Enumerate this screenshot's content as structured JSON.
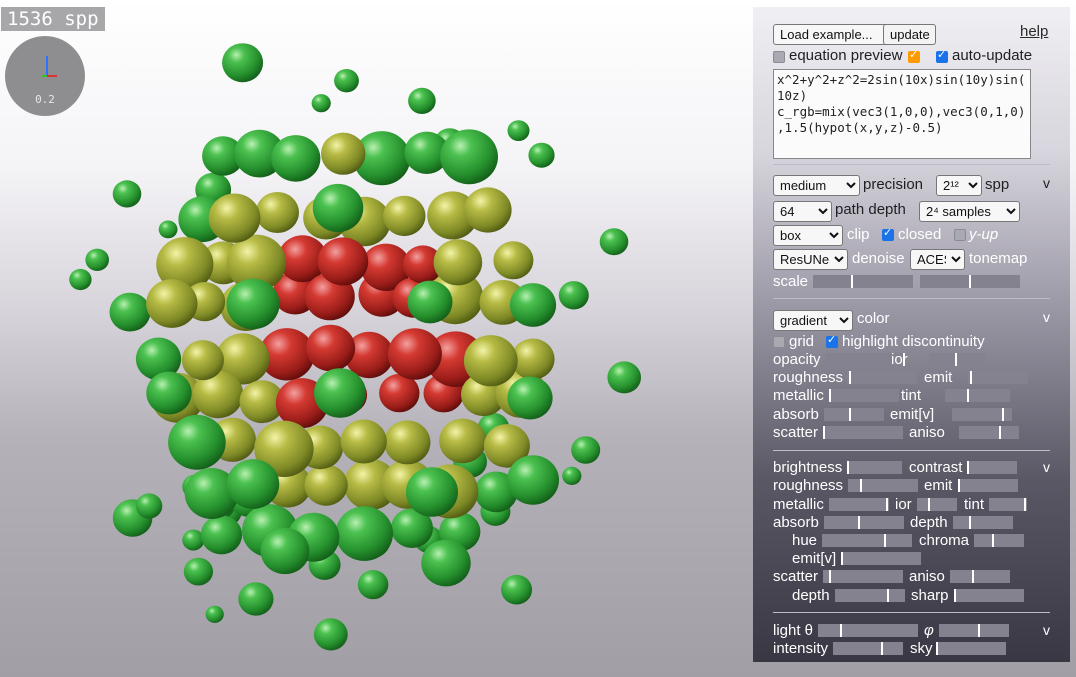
{
  "viewport": {
    "spp_label": "1536 spp",
    "axis_scale": "0.2"
  },
  "panel": {
    "example_select": "Load example...",
    "update_label": "update",
    "help_label": "help",
    "equation_preview": "equation preview",
    "auto_update": "auto-update",
    "equation": "x^2+y^2+z^2=2sin(10x)sin(10y)sin(10z)\nc_rgb=mix(vec3(1,0,0),vec3(0,1,0),1.5(hypot(x,y,z)-0.5)",
    "render": {
      "quality": "medium",
      "precision_label": "precision",
      "spp_select": "2¹²",
      "spp_label": "spp",
      "depth_select": "64",
      "path_depth_label": "path depth",
      "samples_select": "2⁴ samples",
      "clip_select": "box",
      "clip_label": "clip",
      "closed_label": "closed",
      "yup_label": "y-up",
      "denoise_select": "ResUNet",
      "denoise_label": "denoise",
      "tonemap_select": "ACES",
      "tonemap_label": "tonemap",
      "scale_label": "scale"
    },
    "material": {
      "color_select": "gradient",
      "color_label": "color",
      "grid_label": "grid",
      "highlight_label": "highlight discontinuity",
      "rows": [
        [
          "opacity",
          "ior"
        ],
        [
          "roughness",
          "emit"
        ],
        [
          "metallic",
          "tint"
        ],
        [
          "absorb",
          "emit[v]"
        ],
        [
          "scatter",
          "aniso"
        ]
      ]
    },
    "background": {
      "brightness": "brightness",
      "contrast": "contrast",
      "roughness": "roughness",
      "emit": "emit",
      "metallic": "metallic",
      "ior": "ior",
      "tint": "tint",
      "absorb": "absorb",
      "depth": "depth",
      "hue": "hue",
      "chroma": "chroma",
      "emitv": "emit[v]",
      "scatter": "scatter",
      "aniso": "aniso",
      "depth2": "depth",
      "sharp": "sharp"
    },
    "light": {
      "theta": "light θ",
      "phi": "φ",
      "intensity": "intensity",
      "sky": "sky"
    },
    "chevron": "v"
  }
}
